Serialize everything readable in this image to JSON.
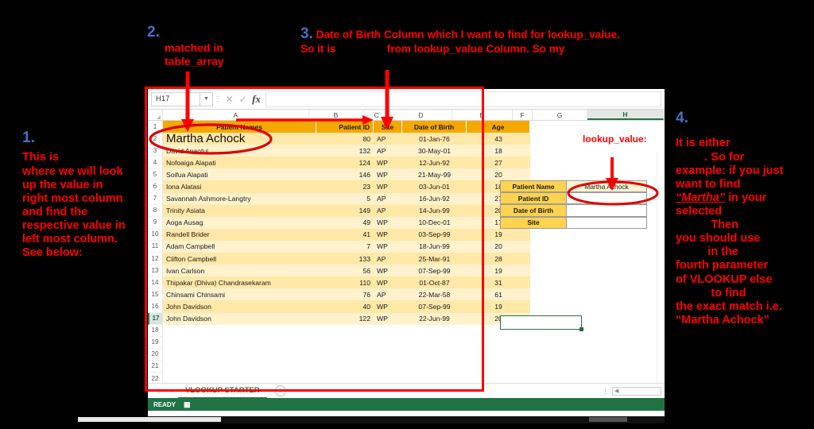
{
  "annotations": {
    "a1": {
      "number": "1.",
      "lines": [
        "This is",
        "where we will look",
        "up the value in",
        "right most column",
        "and find the",
        "respective value in",
        "left most column.",
        "See below:"
      ]
    },
    "a2": {
      "number": "2.",
      "line1": "matched in",
      "line2": "table_array"
    },
    "a3": {
      "number": "3.",
      "line1": "Date of Birth Column which I want to find for lookup_value.",
      "line2_a": "So it is",
      "line2_b": "from lookup_value Column. So my"
    },
    "a4": {
      "number": "4.",
      "line1": "It is either",
      "line2": ". So for",
      "line3": "example: if you just",
      "line4": "want to find",
      "line5_em": "“Martha”",
      "line5_rest": " in your",
      "line6": "selected",
      "line7": "Then",
      "line8": "you should use",
      "line9": "in the",
      "line10": "fourth parameter",
      "line11": "of VLOOKUP else",
      "line12": "to find",
      "line13": "the exact match i.e.",
      "line14": "“Martha Achock”"
    },
    "lookup_label": "lookup_value:"
  },
  "excel": {
    "name_box": "H17",
    "formula_bar_value": "",
    "cancel_icon": "✕",
    "confirm_icon": "✓",
    "function_icon": "fx",
    "dropdown_icon": "▼",
    "column_letters": [
      "A",
      "B",
      "C",
      "D",
      "E",
      "F",
      "G",
      "H"
    ],
    "selected_column": "H",
    "selected_row": "17",
    "table": {
      "headers": [
        "Patient Names",
        "Patient ID",
        "Site",
        "Date of Birth",
        "Age"
      ],
      "rows": [
        {
          "n": "2",
          "name": "Martha Achock",
          "id": "80",
          "site": "AP",
          "dob": "01-Jan-76",
          "age": "43"
        },
        {
          "n": "3",
          "name": "David Anaotui",
          "id": "132",
          "site": "AP",
          "dob": "30-May-01",
          "age": "18"
        },
        {
          "n": "4",
          "name": "Nofoaiga Alapati",
          "id": "124",
          "site": "WP",
          "dob": "12-Jun-92",
          "age": "27"
        },
        {
          "n": "5",
          "name": "Soifua Alapati",
          "id": "146",
          "site": "WP",
          "dob": "21-May-99",
          "age": "20"
        },
        {
          "n": "6",
          "name": "Iona Alatasi",
          "id": "23",
          "site": "WP",
          "dob": "03-Jun-01",
          "age": "18"
        },
        {
          "n": "7",
          "name": "Savannah Ashmore-Langtry",
          "id": "5",
          "site": "AP",
          "dob": "16-Jun-92",
          "age": "27"
        },
        {
          "n": "8",
          "name": "Trinity Asiata",
          "id": "149",
          "site": "AP",
          "dob": "14-Jun-99",
          "age": "20"
        },
        {
          "n": "9",
          "name": "Aoga Ausag",
          "id": "49",
          "site": "WP",
          "dob": "10-Dec-01",
          "age": "17"
        },
        {
          "n": "10",
          "name": "Randell Brider",
          "id": "41",
          "site": "WP",
          "dob": "03-Sep-99",
          "age": "19"
        },
        {
          "n": "11",
          "name": "Adam Campbell",
          "id": "7",
          "site": "WP",
          "dob": "18-Jun-99",
          "age": "20"
        },
        {
          "n": "12",
          "name": "Clifton Campbell",
          "id": "133",
          "site": "AP",
          "dob": "25-Mar-91",
          "age": "28"
        },
        {
          "n": "13",
          "name": "Ivan Carlson",
          "id": "56",
          "site": "WP",
          "dob": "07-Sep-99",
          "age": "19"
        },
        {
          "n": "14",
          "name": "Thipakar (Dhiva) Chandrasekaram",
          "id": "110",
          "site": "WP",
          "dob": "01-Oct-87",
          "age": "31"
        },
        {
          "n": "15",
          "name": "Chinsami Chinsami",
          "id": "76",
          "site": "AP",
          "dob": "22-Mar-58",
          "age": "61"
        },
        {
          "n": "16",
          "name": "John Davidson",
          "id": "40",
          "site": "WP",
          "dob": "07-Sep-99",
          "age": "19"
        },
        {
          "n": "17",
          "name": "John Davidson",
          "id": "122",
          "site": "WP",
          "dob": "22-Jun-99",
          "age": "20"
        }
      ],
      "empty_rows": [
        "18",
        "19",
        "20",
        "21",
        "22"
      ]
    },
    "lookup_form": [
      {
        "key": "Patient Name",
        "value": "Martha Achock"
      },
      {
        "key": "Patient ID",
        "value": ""
      },
      {
        "key": "Date of Birth",
        "value": ""
      },
      {
        "key": "Site",
        "value": ""
      }
    ],
    "sheet_tab": "VLOOKUP STARTER",
    "add_sheet_icon": "+",
    "prev_icon": "‹",
    "next_icon": "›",
    "status_text": "READY",
    "status_icon": "▦"
  },
  "colors": {
    "annotation_red": "#ff0000",
    "annotation_blue": "#4472C4",
    "table_header": "#F5A800",
    "row_dark": "#FFE8A8",
    "row_light": "#FFF2CC",
    "excel_green": "#217346",
    "lookup_key": "#FFD34D"
  }
}
